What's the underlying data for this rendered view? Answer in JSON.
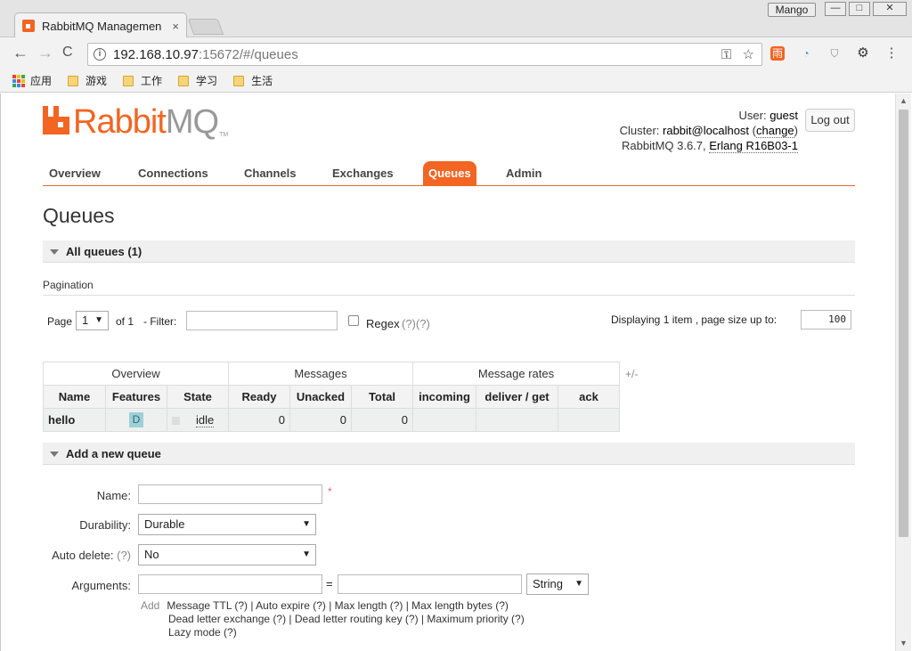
{
  "browser": {
    "tab_title": "RabbitMQ Managemen",
    "tab_close": "×",
    "profile": "Mango",
    "win_min": "—",
    "win_max": "□",
    "win_close": "✕",
    "back": "←",
    "forward": "→",
    "reload": "C",
    "url_host": "192.168.10.97",
    "url_rest": ":15672/#/queues",
    "info_glyph": "i",
    "key_glyph": "⚿",
    "star_glyph": "☆",
    "menu_glyph": "⋮",
    "settings_glyph": "⚙",
    "ext1": "雨",
    "ext2": "◔",
    "ext3": "⛉",
    "bookmarks": [
      {
        "label": "应用"
      },
      {
        "label": "游戏"
      },
      {
        "label": "工作"
      },
      {
        "label": "学习"
      },
      {
        "label": "生活"
      }
    ]
  },
  "header": {
    "logo_rabbit": "Rabbit",
    "logo_mq": "MQ",
    "logo_tm": "TM",
    "user_label": "User:",
    "user": "guest",
    "cluster_label": "Cluster:",
    "cluster": "rabbit@localhost",
    "change": "change",
    "version": "RabbitMQ 3.6.7,",
    "erlang": "Erlang R16B03-1",
    "logout": "Log out"
  },
  "tabs": {
    "overview": "Overview",
    "connections": "Connections",
    "channels": "Channels",
    "exchanges": "Exchanges",
    "queues": "Queues",
    "admin": "Admin"
  },
  "page_title": "Queues",
  "all_queues": {
    "title": "All queues (1)",
    "pagination_label": "Pagination",
    "page_label": "Page",
    "page_value": "1",
    "of_label": "of 1",
    "filter_label": "- Filter:",
    "filter_value": "",
    "regex_label": "Regex",
    "regex_help": "(?)(?)",
    "displaying": "Displaying 1 item , page size up to:",
    "page_size": "100"
  },
  "table": {
    "groups": [
      "Overview",
      "Messages",
      "Message rates"
    ],
    "plus_minus": "+/-",
    "columns": [
      "Name",
      "Features",
      "State",
      "Ready",
      "Unacked",
      "Total",
      "incoming",
      "deliver / get",
      "ack"
    ],
    "rows": [
      {
        "name": "hello",
        "features": "D",
        "state": "idle",
        "ready": "0",
        "unacked": "0",
        "total": "0",
        "incoming": "",
        "deliver_get": "",
        "ack": ""
      }
    ]
  },
  "add_queue": {
    "title": "Add a new queue",
    "name_label": "Name:",
    "name_value": "",
    "required": "*",
    "durability_label": "Durability:",
    "durability_value": "Durable",
    "auto_delete_label": "Auto delete:",
    "auto_delete_help": "(?)",
    "auto_delete_value": "No",
    "arguments_label": "Arguments:",
    "arguments_eq": "=",
    "arguments_type": "String",
    "arguments_key": "",
    "arguments_value": "",
    "add": "Add",
    "links_line1": "Message TTL (?) | Auto expire (?) | Max length (?) | Max length bytes (?)",
    "links_line2": "Dead letter exchange (?) | Dead letter routing key (?) | Maximum priority (?)",
    "links_line3": "Lazy mode (?)"
  },
  "colors": {
    "accent": "#f26522",
    "durable_badge": "#9ed0d6"
  }
}
